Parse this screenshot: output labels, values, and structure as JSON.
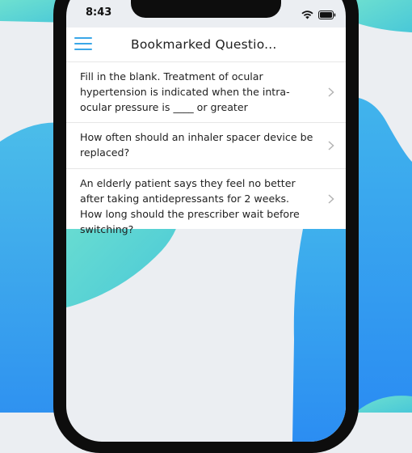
{
  "status_bar": {
    "time": "8:43",
    "icons": [
      "wifi-icon",
      "battery-icon"
    ]
  },
  "header": {
    "menu_icon": "hamburger-menu-icon",
    "title": "Bookmarked Questio..."
  },
  "questions": [
    {
      "text": "Fill in the blank. Treatment of ocular hypertension is indicated when the intra-ocular pressure is ____ or greater"
    },
    {
      "text": "How often should an inhaler spacer device be replaced?"
    },
    {
      "text": "An elderly patient says they feel no better after taking antidepressants for 2 weeks. How long should the prescriber wait before switching?"
    }
  ],
  "colors": {
    "accent": "#3aa7e8",
    "teal": "#5fd8cf",
    "blue": "#2f8ff1",
    "background": "#ebeef2"
  }
}
